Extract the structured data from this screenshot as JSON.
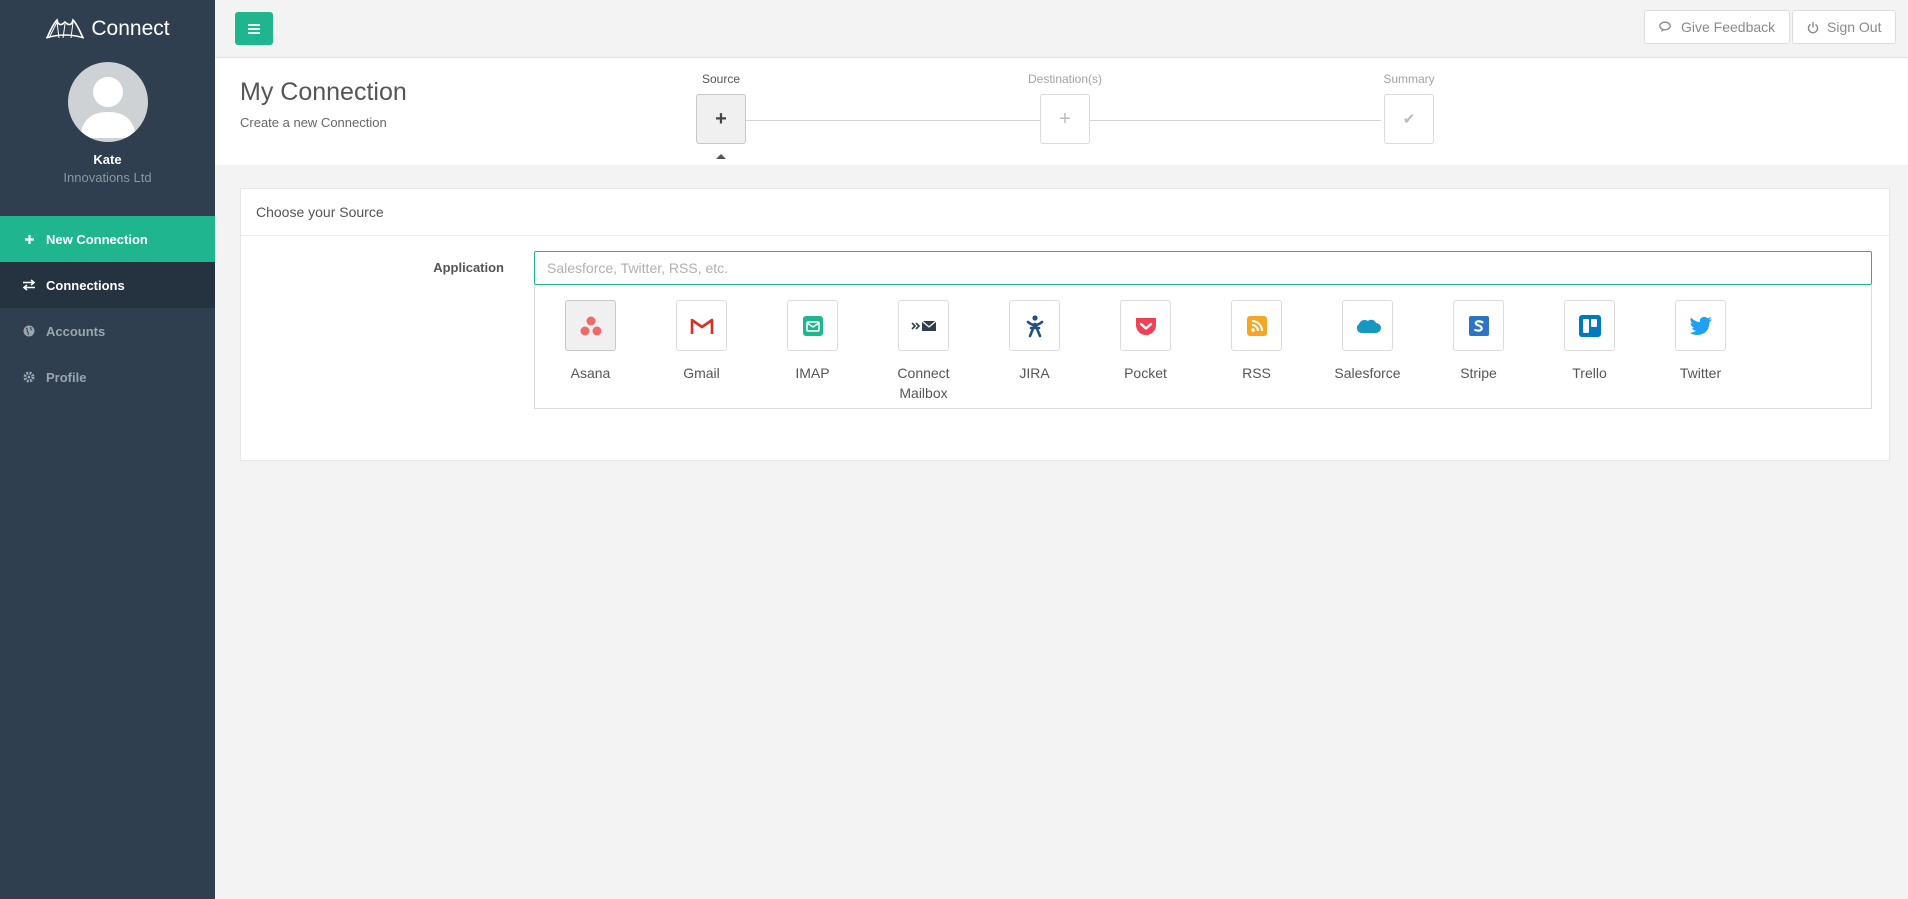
{
  "brand": {
    "name": "Connect"
  },
  "user": {
    "name": "Kate",
    "org": "Innovations Ltd"
  },
  "nav": [
    {
      "label": "New Connection",
      "icon": "plus-icon"
    },
    {
      "label": "Connections",
      "icon": "exchange-icon"
    },
    {
      "label": "Accounts",
      "icon": "globe-icon"
    },
    {
      "label": "Profile",
      "icon": "gear-icon"
    }
  ],
  "topbar": {
    "feedback_label": "Give Feedback",
    "signout_label": "Sign Out"
  },
  "header": {
    "title": "My Connection",
    "subtitle": "Create a new Connection"
  },
  "steps": [
    {
      "label": "Source",
      "symbol": "+"
    },
    {
      "label": "Destination(s)",
      "symbol": "+"
    },
    {
      "label": "Summary",
      "symbol": "✔"
    }
  ],
  "panel": {
    "title": "Choose your Source",
    "field_label": "Application",
    "search_placeholder": "Salesforce, Twitter, RSS, etc.",
    "apps": [
      {
        "name": "Asana",
        "icon": "asana-icon",
        "color": "#f06a6a"
      },
      {
        "name": "Gmail",
        "icon": "gmail-icon",
        "color": "#d93025"
      },
      {
        "name": "IMAP",
        "icon": "imap-envelope-icon",
        "color": "#1fb58f"
      },
      {
        "name": "Connect\nMailbox",
        "icon": "connect-mailbox-icon",
        "color": "#2f3f4f"
      },
      {
        "name": "JIRA",
        "icon": "jira-icon",
        "color": "#205081"
      },
      {
        "name": "Pocket",
        "icon": "pocket-icon",
        "color": "#ef4056"
      },
      {
        "name": "RSS",
        "icon": "rss-icon",
        "color": "#f5a623"
      },
      {
        "name": "Salesforce",
        "icon": "salesforce-icon",
        "color": "#1798c1"
      },
      {
        "name": "Stripe",
        "icon": "stripe-icon",
        "color": "#2d75c3"
      },
      {
        "name": "Trello",
        "icon": "trello-icon",
        "color": "#0079bf"
      },
      {
        "name": "Twitter",
        "icon": "twitter-icon",
        "color": "#1da1f2"
      }
    ]
  }
}
